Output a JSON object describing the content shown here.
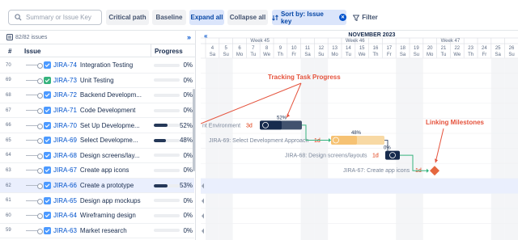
{
  "toolbar": {
    "search_placeholder": "Summary or Issue Key",
    "critical_path": "Critical path",
    "baseline": "Baseline",
    "expand_all": "Expand all",
    "collapse_all": "Collapse all",
    "sort_by": "Sort by: Issue key",
    "filter": "Filter"
  },
  "left": {
    "count": "82/82",
    "count_suffix": "issues",
    "col_num": "#",
    "col_issue": "Issue",
    "col_progress": "Progress",
    "collapse_icon": "double-chevron-right-icon"
  },
  "rows": [
    {
      "num": "70",
      "key": "JIRA-74",
      "title": "Integration Testing",
      "progress": 0,
      "pct": "0%",
      "type": "task"
    },
    {
      "num": "69",
      "key": "JIRA-73",
      "title": "Unit Testing",
      "progress": 0,
      "pct": "0%",
      "type": "story"
    },
    {
      "num": "68",
      "key": "JIRA-72",
      "title": "Backend Developm...",
      "progress": 0,
      "pct": "0%",
      "type": "task"
    },
    {
      "num": "67",
      "key": "JIRA-71",
      "title": "Code Development",
      "progress": 0,
      "pct": "0%",
      "type": "task"
    },
    {
      "num": "66",
      "key": "JIRA-70",
      "title": "Set Up Developme...",
      "progress": 52,
      "pct": "52%",
      "type": "task"
    },
    {
      "num": "65",
      "key": "JIRA-69",
      "title": "Select Developme...",
      "progress": 48,
      "pct": "48%",
      "type": "task"
    },
    {
      "num": "64",
      "key": "JIRA-68",
      "title": "Design screens/lay...",
      "progress": 0,
      "pct": "0%",
      "type": "task"
    },
    {
      "num": "63",
      "key": "JIRA-67",
      "title": "Create app icons",
      "progress": 0,
      "pct": "0%",
      "type": "task"
    },
    {
      "num": "62",
      "key": "JIRA-66",
      "title": "Create a prototype",
      "progress": 53,
      "pct": "53%",
      "type": "task"
    },
    {
      "num": "61",
      "key": "JIRA-65",
      "title": "Design app mockups",
      "progress": 0,
      "pct": "0%",
      "type": "task"
    },
    {
      "num": "60",
      "key": "JIRA-64",
      "title": "Wireframing design",
      "progress": 0,
      "pct": "0%",
      "type": "task"
    },
    {
      "num": "59",
      "key": "JIRA-63",
      "title": "Market research",
      "progress": 0,
      "pct": "0%",
      "type": "task"
    }
  ],
  "gantt": {
    "month": "NOVEMBER 2023",
    "weeks": [
      "Week 45",
      "Week 46",
      "Week 47"
    ],
    "days": [
      {
        "n": "4",
        "d": "Sa"
      },
      {
        "n": "5",
        "d": "Su"
      },
      {
        "n": "6",
        "d": "Mo"
      },
      {
        "n": "7",
        "d": "Tu"
      },
      {
        "n": "8",
        "d": "We"
      },
      {
        "n": "9",
        "d": "Th"
      },
      {
        "n": "10",
        "d": "Fr"
      },
      {
        "n": "11",
        "d": "Sa"
      },
      {
        "n": "12",
        "d": "Su"
      },
      {
        "n": "13",
        "d": "Mo"
      },
      {
        "n": "14",
        "d": "Tu"
      },
      {
        "n": "15",
        "d": "We"
      },
      {
        "n": "16",
        "d": "Th"
      },
      {
        "n": "17",
        "d": "Fr"
      },
      {
        "n": "18",
        "d": "Sa"
      },
      {
        "n": "19",
        "d": "Su"
      },
      {
        "n": "20",
        "d": "Mo"
      },
      {
        "n": "21",
        "d": "Tu"
      },
      {
        "n": "22",
        "d": "We"
      },
      {
        "n": "23",
        "d": "Th"
      },
      {
        "n": "24",
        "d": "Fr"
      },
      {
        "n": "25",
        "d": "Sa"
      },
      {
        "n": "26",
        "d": "Su"
      }
    ],
    "bar70_label": "52%",
    "bar70_side": "nt Environment",
    "bar70_dur": "3d",
    "bar69_label": "48%",
    "bar69_side": "JIRA-69: Select Development Approach",
    "bar69_dur": "1d",
    "bar68_label": "0%",
    "bar68_side": "JIRA-68: Design screens/layouts",
    "bar68_dur": "1d",
    "bar67_side": "JIRA-67: Create app icons",
    "bar67_dur": "1d",
    "annotation_progress": "Tracking Task Progress",
    "annotation_milestones": "Linking Milestones"
  }
}
